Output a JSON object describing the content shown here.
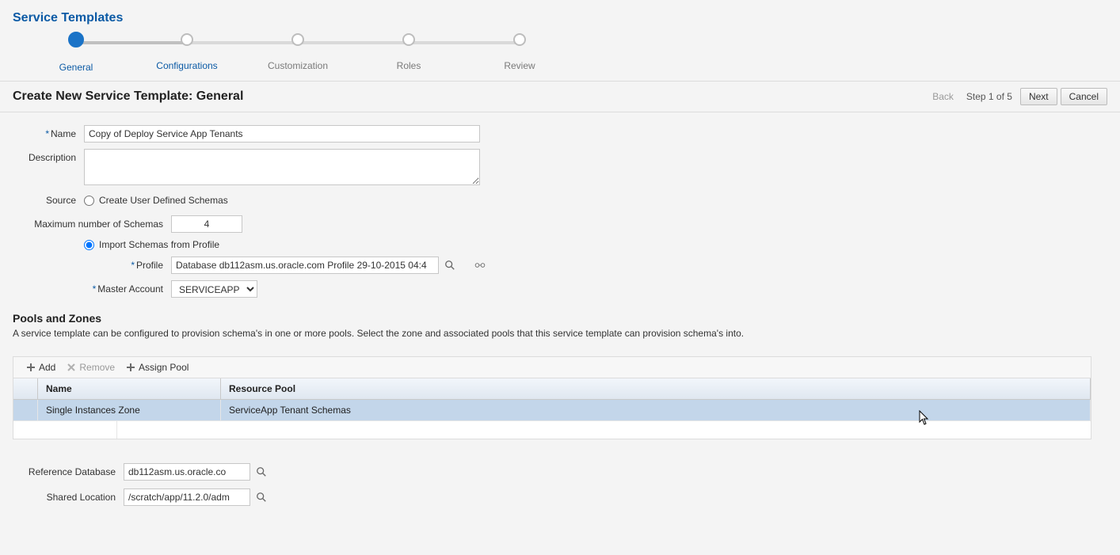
{
  "page_title": "Service Templates",
  "steps": [
    "General",
    "Configurations",
    "Customization",
    "Roles",
    "Review"
  ],
  "content_title": "Create New Service Template: General",
  "buttons": {
    "back": "Back",
    "step_indicator": "Step 1 of 5",
    "next": "Next",
    "cancel": "Cancel"
  },
  "form": {
    "name_label": "Name",
    "name_value": "Copy of Deploy Service App Tenants",
    "description_label": "Description",
    "description_value": "",
    "source_label": "Source",
    "source_options": {
      "create": "Create User Defined Schemas",
      "import": "Import Schemas from Profile"
    },
    "source_selected": "import",
    "max_schemas_label": "Maximum number of Schemas",
    "max_schemas_value": "4",
    "profile_label": "Profile",
    "profile_value": "Database db112asm.us.oracle.com Profile 29-10-2015 04:4",
    "master_account_label": "Master Account",
    "master_account_value": "SERVICEAPP"
  },
  "pools": {
    "title": "Pools and Zones",
    "desc": "A service template can be configured to provision schema's in one or more pools. Select the zone and associated pools that this service template can provision schema's into.",
    "toolbar": {
      "add": "Add",
      "remove": "Remove",
      "assign": "Assign Pool"
    },
    "columns": [
      "Name",
      "Resource Pool"
    ],
    "rows": [
      {
        "name": "Single Instances Zone",
        "pool": "ServiceApp Tenant Schemas",
        "selected": true
      }
    ]
  },
  "lower": {
    "ref_db_label": "Reference Database",
    "ref_db_value": "db112asm.us.oracle.co",
    "shared_label": "Shared Location",
    "shared_value": "/scratch/app/11.2.0/adm"
  }
}
